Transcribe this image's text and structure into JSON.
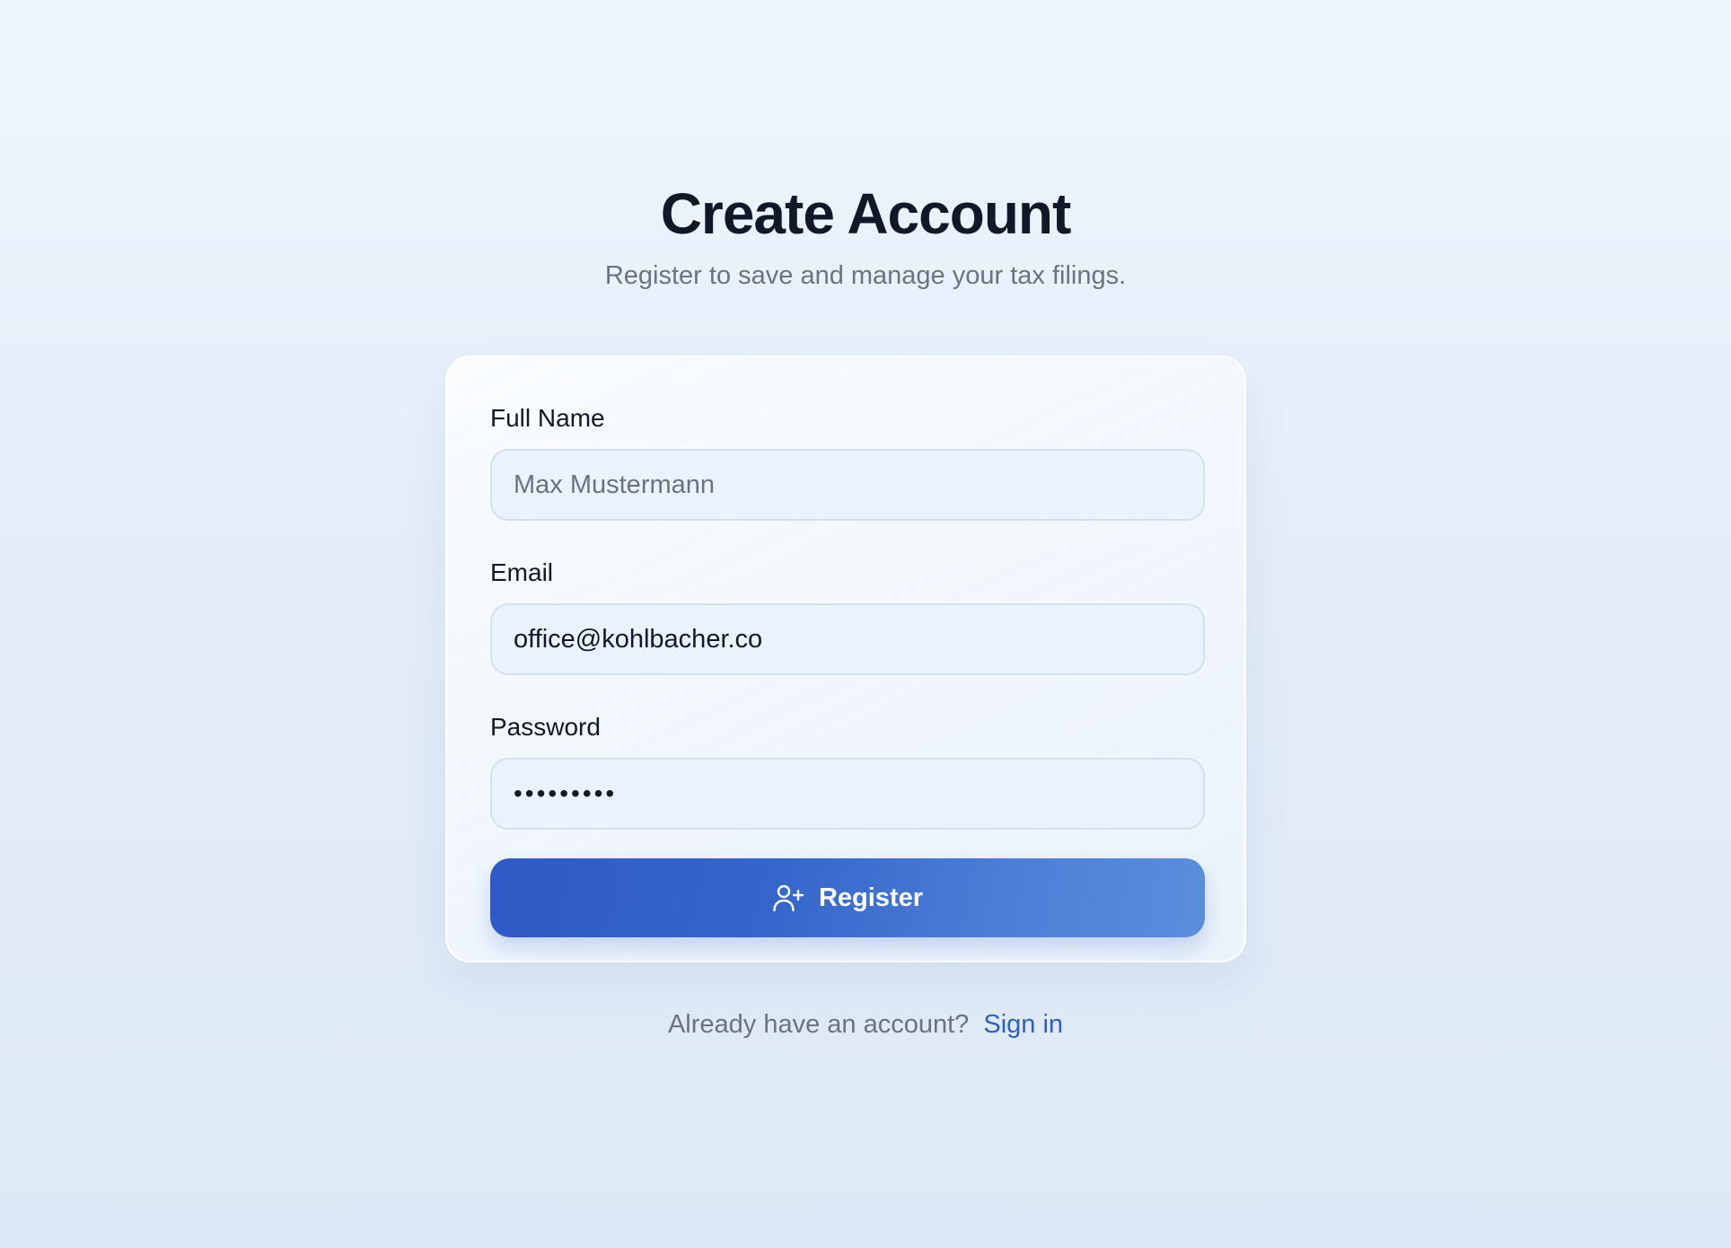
{
  "header": {
    "title": "Create Account",
    "subtitle": "Register to save and manage your tax filings."
  },
  "form": {
    "full_name": {
      "label": "Full Name",
      "placeholder": "Max Mustermann",
      "value": ""
    },
    "email": {
      "label": "Email",
      "placeholder": "",
      "value": "office@kohlbacher.co"
    },
    "password": {
      "label": "Password",
      "value": "secret123"
    },
    "register_button": {
      "label": "Register",
      "icon": "user-plus-icon"
    }
  },
  "footer": {
    "prompt": "Already have an account?",
    "link_label": "Sign in"
  },
  "colors": {
    "accent": "#2f59c6",
    "link": "#2f5fc6",
    "muted_text": "#6b7280",
    "heading_text": "#111827"
  }
}
